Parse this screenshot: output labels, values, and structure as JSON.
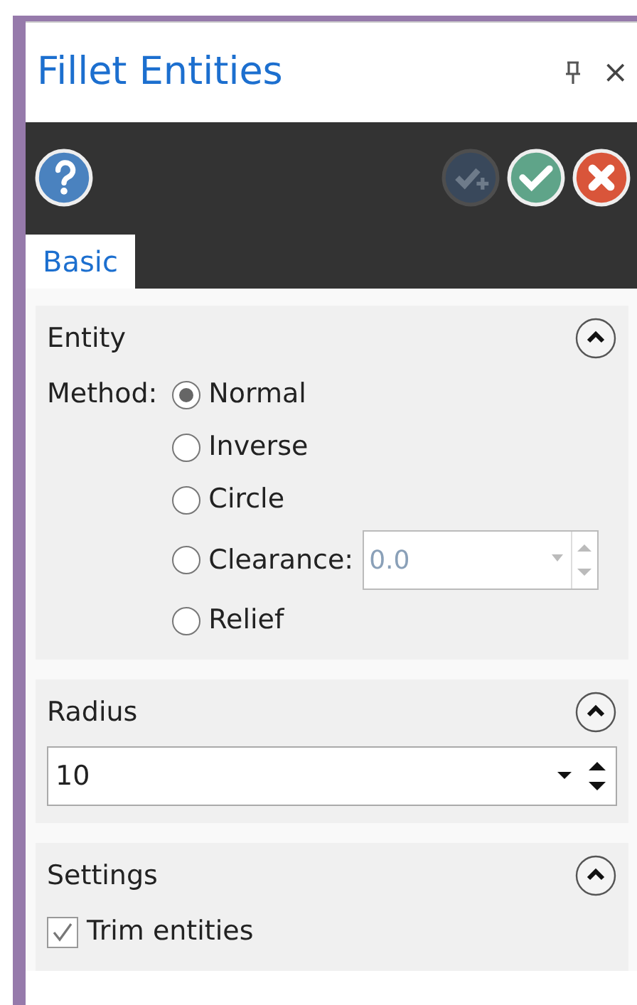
{
  "window": {
    "title": "Fillet Entities",
    "close": "×"
  },
  "toolbar": [
    {
      "kind": "help",
      "disabled": false
    },
    {
      "kind": "apply",
      "disabled": true
    },
    {
      "kind": "ok",
      "disabled": false
    },
    {
      "kind": "cancel",
      "disabled": false
    }
  ],
  "tabs": [
    {
      "label": "Basic",
      "selected": true
    }
  ],
  "sections": [
    {
      "kind": "radios",
      "title": "Entity",
      "expanded": true,
      "label": "Method:",
      "options": [
        {
          "label": "Normal",
          "selected": true
        },
        {
          "label": "Inverse",
          "selected": false
        },
        {
          "label": "Circle",
          "selected": false
        },
        {
          "label": "Clearance:",
          "selected": false,
          "field": {
            "value": "0.0",
            "disabled": true
          }
        },
        {
          "label": "Relief",
          "selected": false
        }
      ]
    },
    {
      "kind": "spin",
      "title": "Radius",
      "expanded": true,
      "value": "10"
    },
    {
      "kind": "checks",
      "title": "Settings",
      "expanded": true,
      "items": [
        {
          "label": "Trim entities",
          "checked": true
        }
      ]
    }
  ]
}
